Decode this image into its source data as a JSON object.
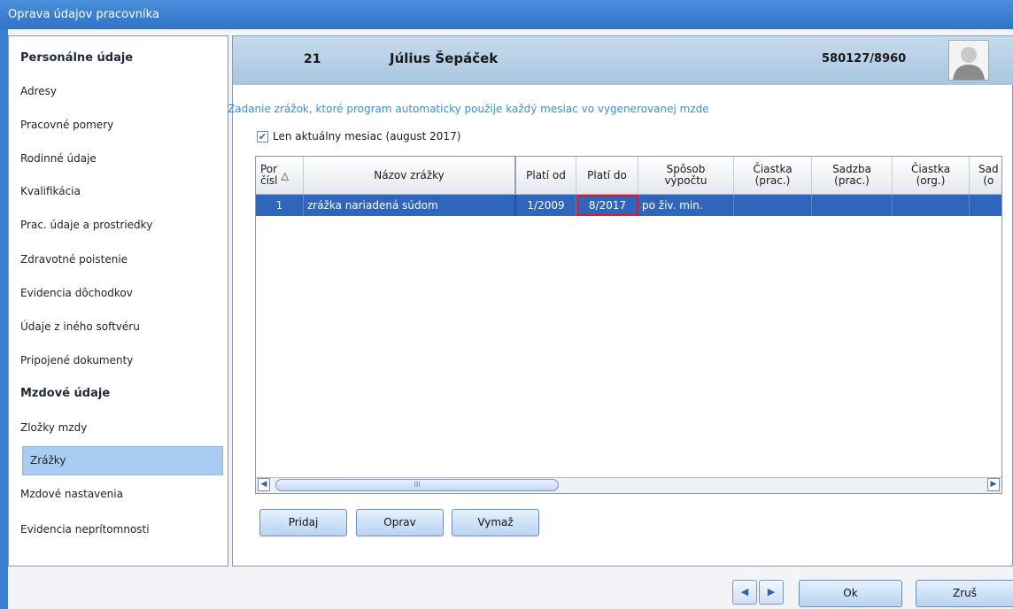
{
  "window": {
    "title": "Oprava údajov pracovníka"
  },
  "sidebar": {
    "personal_header": "Personálne údaje",
    "personal_items": [
      "Adresy",
      "Pracovné pomery",
      "Rodinné údaje",
      "Kvalifikácia",
      "Prac. údaje a prostriedky",
      "Zdravotné poistenie",
      "Evidencia dôchodkov",
      "Údaje z iného softvéru",
      "Pripojené dokumenty"
    ],
    "wage_header": "Mzdové údaje",
    "wage_items": [
      "Zložky mzdy",
      "Zrážky",
      "Mzdové nastavenia",
      "Evidencia neprítomnosti"
    ],
    "active_item": "Zrážky"
  },
  "employee": {
    "number": "21",
    "name": "Július Šepáček",
    "id": "580127/8960"
  },
  "content": {
    "hint": "Zadanie zrážok, ktoré program automaticky použije každý mesiac vo vygenerovanej mzde",
    "checkbox_label": "Len aktuálny mesiac (august 2017)",
    "checkbox_checked": true
  },
  "grid": {
    "columns": [
      {
        "line1": "Por",
        "line2": "čísl",
        "sort": "△"
      },
      {
        "line1": "Názov zrážky",
        "line2": ""
      },
      {
        "line1": "Platí od",
        "line2": ""
      },
      {
        "line1": "Platí do",
        "line2": ""
      },
      {
        "line1": "Spôsob",
        "line2": "výpočtu"
      },
      {
        "line1": "Čiastka",
        "line2": "(prac.)"
      },
      {
        "line1": "Sadzba",
        "line2": "(prac.)"
      },
      {
        "line1": "Čiastka",
        "line2": "(org.)"
      },
      {
        "line1": "Sad",
        "line2": "(o"
      }
    ],
    "rows": [
      [
        "1",
        "zrážka nariadená súdom",
        "1/2009",
        "8/2017",
        "po živ. min.",
        "",
        "",
        "",
        ""
      ]
    ],
    "scroll_thumb_label": "III",
    "scroll_left": "◀",
    "scroll_right": "▶"
  },
  "buttons": {
    "add": "Pridaj",
    "edit": "Oprav",
    "delete": "Vymaž",
    "ok": "Ok",
    "cancel": "Zruš"
  },
  "nav": {
    "prev": "◀",
    "next": "▶"
  },
  "colors": {
    "selection": "#2f66bb",
    "accent": "#3a8fd6",
    "focus_border": "#e01b24"
  }
}
